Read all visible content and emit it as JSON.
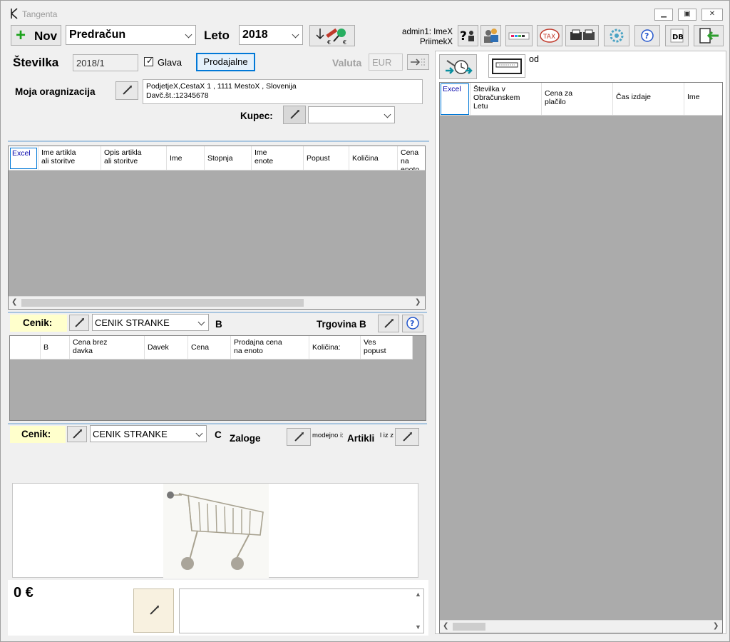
{
  "window": {
    "title": "Tangenta"
  },
  "toolbar": {
    "new_label": "Nov",
    "doc_type": "Predračun",
    "year_label": "Leto",
    "year_value": "2018",
    "user_line1": "admin1: ImeX",
    "user_line2": "PriimekX",
    "tax_label": "TAX",
    "db_label": "DB"
  },
  "header": {
    "number_label": "Številka",
    "number_value": "2018/1",
    "glava_label": "Glava",
    "shops_button": "Prodajalne",
    "currency_label": "Valuta",
    "currency_value": "EUR",
    "org_label": "Moja oragnizacija",
    "org_line1": "PodjetjeX,CestaX 1 , 1111 MestoX , Slovenija",
    "org_line2": "Davč.št.:12345678",
    "buyer_label": "Kupec:"
  },
  "items_table": {
    "excel_label": "Excel",
    "columns": [
      "Ime artikla\nali storitve",
      "Opis artikla\nali storitve",
      "Ime",
      "Stopnja",
      "Ime\nenote",
      "Popust",
      "Količina",
      "Cena na\nenoto"
    ]
  },
  "pricelist_b": {
    "label": "Cenik:",
    "value": "CENIK STRANKE",
    "letter": "B",
    "shop_label": "Trgovina B",
    "columns": [
      "",
      "B",
      "Cena brez\ndavka",
      "Davek",
      "Cena",
      "Prodajna cena\nna enoto",
      "Količina:",
      "Ves\npopust"
    ]
  },
  "pricelist_c": {
    "label": "Cenik:",
    "value": "CENIK STRANKE",
    "letter": "C",
    "stock_label": "Zaloge",
    "modejno_text": "modejno i:",
    "articles_label": "Artikli",
    "articles_suffix": "l iz z"
  },
  "footer": {
    "total": "0 €"
  },
  "right_panel": {
    "od_label": "od",
    "excel_label": "Excel",
    "columns": [
      "Številka v\nObračunskem\nLetu",
      "Cena za\nplačilo",
      "Čas izdaje",
      "Ime"
    ]
  },
  "colors": {
    "accent_blue": "#0078d7",
    "highlight_yellow": "#ffffcc",
    "grid_gray": "#ababab"
  }
}
